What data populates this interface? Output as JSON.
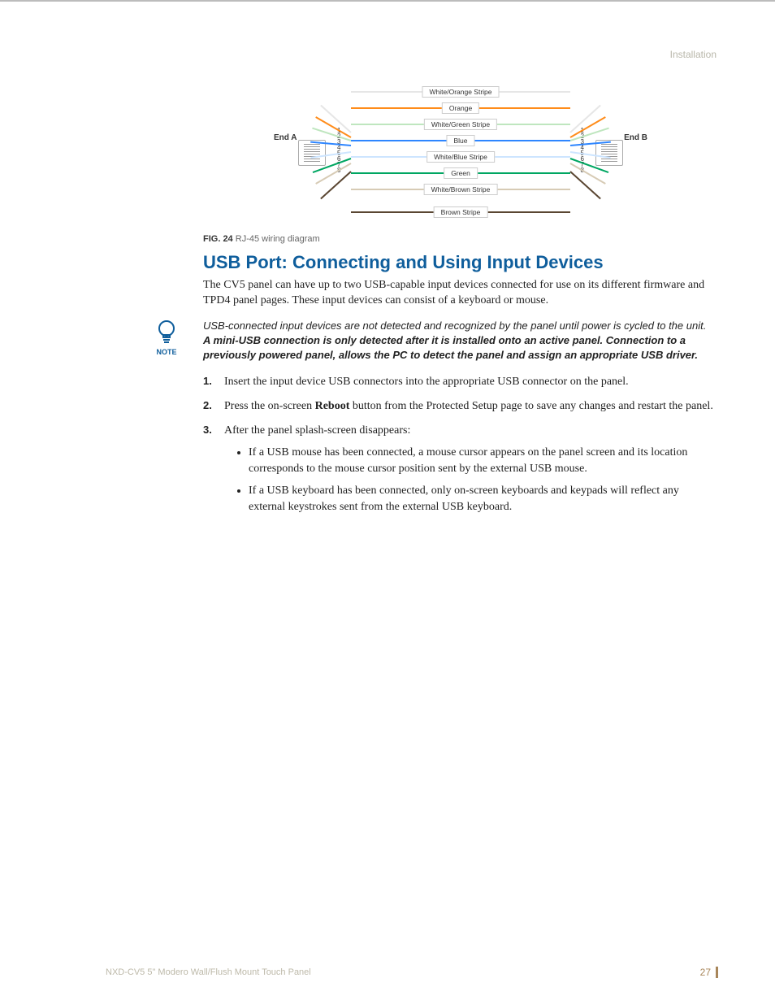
{
  "header": {
    "section": "Installation"
  },
  "diagram": {
    "endA": "End A",
    "endB": "End B",
    "pins": [
      "1",
      "2",
      "3",
      "4",
      "5",
      "6",
      "7",
      "8"
    ],
    "wires": [
      {
        "pin": 1,
        "label": "White/Orange Stripe",
        "color": "#e6e6e6"
      },
      {
        "pin": 2,
        "label": "Orange",
        "color": "#ff8c1a"
      },
      {
        "pin": 3,
        "label": "White/Green Stripe",
        "color": "#bfe6bf"
      },
      {
        "pin": 4,
        "label": "Blue",
        "color": "#2e86ff"
      },
      {
        "pin": 5,
        "label": "White/Blue Stripe",
        "color": "#cde5ff"
      },
      {
        "pin": 6,
        "label": "Green",
        "color": "#00a662"
      },
      {
        "pin": 7,
        "label": "White/Brown Stripe",
        "color": "#d7cbb5"
      },
      {
        "pin": 8,
        "label": "Brown Stripe",
        "color": "#5a4632"
      }
    ]
  },
  "caption": {
    "prefix": "FIG. 24",
    "text": "  RJ-45 wiring diagram"
  },
  "h2": "USB Port: Connecting and Using Input Devices",
  "intro": "The CV5 panel can have up to two USB-capable input devices connected for use on its different firmware and TPD4 panel pages. These input devices can consist of a keyboard or mouse.",
  "note": {
    "label": "NOTE",
    "line1": "USB-connected input devices are not detected and recognized by the panel until power is cycled to the unit.",
    "line2": "A mini-USB connection is only detected after it is installed onto an active panel. Connection to a previously powered panel, allows the PC to detect the panel and assign an appropriate USB driver."
  },
  "steps": {
    "s1": "Insert the input device USB connectors into the appropriate USB connector on the panel.",
    "s2a": "Press the on-screen ",
    "s2b": "Reboot",
    "s2c": " button from the Protected Setup page to save any changes and restart the panel.",
    "s3": "After the panel splash-screen disappears:",
    "s3b1": "If a USB mouse has been connected, a mouse cursor appears on the panel screen and its location corresponds to the mouse cursor position sent by the external USB mouse.",
    "s3b2": "If a USB keyboard has been connected, only on-screen keyboards and keypads will reflect any external keystrokes sent from the external USB keyboard."
  },
  "footer": {
    "left": "NXD-CV5 5\" Modero Wall/Flush Mount Touch Panel",
    "page": "27"
  }
}
